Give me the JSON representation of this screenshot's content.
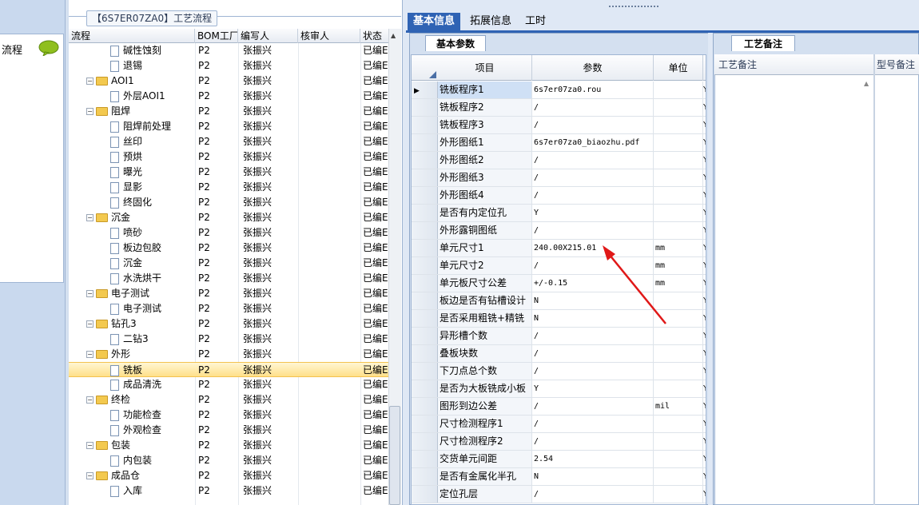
{
  "left_strip": {
    "label": "流程"
  },
  "tree": {
    "title": "【6S7ER07ZA0】工艺流程",
    "columns": [
      "流程",
      "BOM工厂",
      "编写人",
      "核审人",
      "状态"
    ],
    "rows": [
      {
        "name": "碱性蚀刻",
        "level": 2,
        "type": "doc",
        "bom": "P2",
        "writer": "张振兴",
        "status": "已编E"
      },
      {
        "name": "退锡",
        "level": 2,
        "type": "doc",
        "bom": "P2",
        "writer": "张振兴",
        "status": "已编E"
      },
      {
        "name": "AOI1",
        "level": 1,
        "type": "folder",
        "bom": "P2",
        "writer": "张振兴",
        "status": "已编E"
      },
      {
        "name": "外层AOI1",
        "level": 2,
        "type": "doc",
        "bom": "P2",
        "writer": "张振兴",
        "status": "已编E"
      },
      {
        "name": "阻焊",
        "level": 1,
        "type": "folder",
        "bom": "P2",
        "writer": "张振兴",
        "status": "已编E"
      },
      {
        "name": "阻焊前处理",
        "level": 2,
        "type": "doc",
        "bom": "P2",
        "writer": "张振兴",
        "status": "已编E"
      },
      {
        "name": "丝印",
        "level": 2,
        "type": "doc",
        "bom": "P2",
        "writer": "张振兴",
        "status": "已编E"
      },
      {
        "name": "预烘",
        "level": 2,
        "type": "doc",
        "bom": "P2",
        "writer": "张振兴",
        "status": "已编E"
      },
      {
        "name": "曝光",
        "level": 2,
        "type": "doc",
        "bom": "P2",
        "writer": "张振兴",
        "status": "已编E"
      },
      {
        "name": "显影",
        "level": 2,
        "type": "doc",
        "bom": "P2",
        "writer": "张振兴",
        "status": "已编E"
      },
      {
        "name": "终固化",
        "level": 2,
        "type": "doc",
        "bom": "P2",
        "writer": "张振兴",
        "status": "已编E"
      },
      {
        "name": "沉金",
        "level": 1,
        "type": "folder",
        "bom": "P2",
        "writer": "张振兴",
        "status": "已编E"
      },
      {
        "name": "喷砂",
        "level": 2,
        "type": "doc",
        "bom": "P2",
        "writer": "张振兴",
        "status": "已编E"
      },
      {
        "name": "板边包胶",
        "level": 2,
        "type": "doc",
        "bom": "P2",
        "writer": "张振兴",
        "status": "已编E"
      },
      {
        "name": "沉金",
        "level": 2,
        "type": "doc",
        "bom": "P2",
        "writer": "张振兴",
        "status": "已编E"
      },
      {
        "name": "水洗烘干",
        "level": 2,
        "type": "doc",
        "bom": "P2",
        "writer": "张振兴",
        "status": "已编E"
      },
      {
        "name": "电子测试",
        "level": 1,
        "type": "folder",
        "bom": "P2",
        "writer": "张振兴",
        "status": "已编E"
      },
      {
        "name": "电子测试",
        "level": 2,
        "type": "doc",
        "bom": "P2",
        "writer": "张振兴",
        "status": "已编E"
      },
      {
        "name": "钻孔3",
        "level": 1,
        "type": "folder",
        "bom": "P2",
        "writer": "张振兴",
        "status": "已编E"
      },
      {
        "name": "二钻3",
        "level": 2,
        "type": "doc",
        "bom": "P2",
        "writer": "张振兴",
        "status": "已编E"
      },
      {
        "name": "外形",
        "level": 1,
        "type": "folder",
        "bom": "P2",
        "writer": "张振兴",
        "status": "已编E"
      },
      {
        "name": "铣板",
        "level": 2,
        "type": "doc",
        "bom": "P2",
        "writer": "张振兴",
        "status": "已编E",
        "selected": true
      },
      {
        "name": "成品清洗",
        "level": 2,
        "type": "doc",
        "bom": "P2",
        "writer": "张振兴",
        "status": "已编E"
      },
      {
        "name": "终检",
        "level": 1,
        "type": "folder",
        "bom": "P2",
        "writer": "张振兴",
        "status": "已编E"
      },
      {
        "name": "功能检查",
        "level": 2,
        "type": "doc",
        "bom": "P2",
        "writer": "张振兴",
        "status": "已编E"
      },
      {
        "name": "外观检查",
        "level": 2,
        "type": "doc",
        "bom": "P2",
        "writer": "张振兴",
        "status": "已编E"
      },
      {
        "name": "包装",
        "level": 1,
        "type": "folder",
        "bom": "P2",
        "writer": "张振兴",
        "status": "已编E"
      },
      {
        "name": "内包装",
        "level": 2,
        "type": "doc",
        "bom": "P2",
        "writer": "张振兴",
        "status": "已编E"
      },
      {
        "name": "成品仓",
        "level": 1,
        "type": "folder",
        "bom": "P2",
        "writer": "张振兴",
        "status": "已编E"
      },
      {
        "name": "入库",
        "level": 2,
        "type": "doc",
        "bom": "P2",
        "writer": "张振兴",
        "status": "已编E"
      }
    ]
  },
  "top_tabs": [
    "基本信息",
    "拓展信息",
    "工时"
  ],
  "basic": {
    "tab_label": "基本参数",
    "columns": [
      "项目",
      "参数",
      "单位"
    ],
    "rows": [
      {
        "item": "铣板程序1",
        "param": "6s7er07za0.rou",
        "unit": "",
        "extra": "Y",
        "current": true
      },
      {
        "item": "铣板程序2",
        "param": "/",
        "unit": "",
        "extra": "Y"
      },
      {
        "item": "铣板程序3",
        "param": "/",
        "unit": "",
        "extra": "Y"
      },
      {
        "item": "外形图纸1",
        "param": "6s7er07za0_biaozhu.pdf",
        "unit": "",
        "extra": "Y"
      },
      {
        "item": "外形图纸2",
        "param": "/",
        "unit": "",
        "extra": "Y"
      },
      {
        "item": "外形图纸3",
        "param": "/",
        "unit": "",
        "extra": "Y"
      },
      {
        "item": "外形图纸4",
        "param": "/",
        "unit": "",
        "extra": "Y"
      },
      {
        "item": "是否有内定位孔",
        "param": "Y",
        "unit": "",
        "extra": "Y"
      },
      {
        "item": "外形露铜图纸",
        "param": "/",
        "unit": "",
        "extra": "Y"
      },
      {
        "item": "单元尺寸1",
        "param": "240.00X215.01",
        "unit": "mm",
        "extra": "Y"
      },
      {
        "item": "单元尺寸2",
        "param": "/",
        "unit": "mm",
        "extra": "Y"
      },
      {
        "item": "单元板尺寸公差",
        "param": "+/-0.15",
        "unit": "mm",
        "extra": "Y"
      },
      {
        "item": "板边是否有钻槽设计",
        "param": "N",
        "unit": "",
        "extra": "Y"
      },
      {
        "item": "是否采用粗铣+精铣",
        "param": "N",
        "unit": "",
        "extra": "Y"
      },
      {
        "item": "异形槽个数",
        "param": "/",
        "unit": "",
        "extra": "Y"
      },
      {
        "item": "叠板块数",
        "param": "/",
        "unit": "",
        "extra": "Y"
      },
      {
        "item": "下刀点总个数",
        "param": "/",
        "unit": "",
        "extra": "Y"
      },
      {
        "item": "是否为大板铣成小板",
        "param": "Y",
        "unit": "",
        "extra": "Y"
      },
      {
        "item": "图形到边公差",
        "param": "/",
        "unit": "mil",
        "extra": "Y"
      },
      {
        "item": "尺寸检测程序1",
        "param": "/",
        "unit": "",
        "extra": "Y"
      },
      {
        "item": "尺寸检测程序2",
        "param": "/",
        "unit": "",
        "extra": "Y"
      },
      {
        "item": "交货单元间距",
        "param": "2.54",
        "unit": "",
        "extra": "Y"
      },
      {
        "item": "是否有金属化半孔",
        "param": "N",
        "unit": "",
        "extra": "Y"
      },
      {
        "item": "定位孔层",
        "param": "/",
        "unit": "",
        "extra": "Y"
      }
    ]
  },
  "remarks": {
    "tab_label": "工艺备注",
    "columns": [
      "工艺备注",
      "型号备注"
    ]
  },
  "colors": {
    "accent": "#2f63b4",
    "arrow": "#e01818",
    "selection": "#ffe08a"
  }
}
